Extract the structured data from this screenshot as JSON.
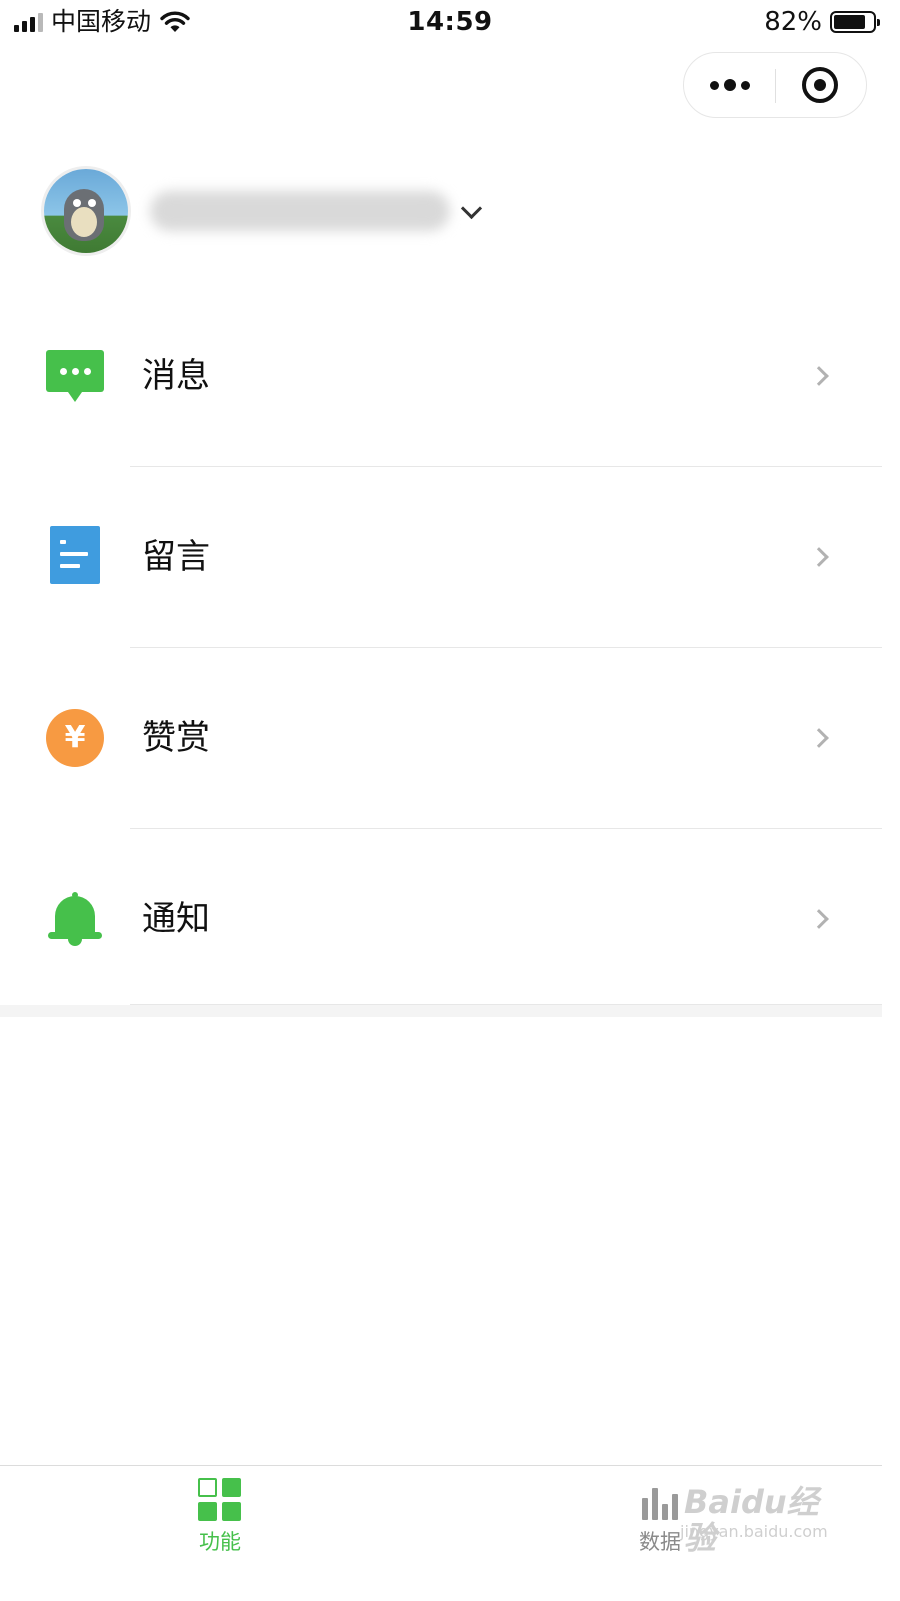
{
  "status_bar": {
    "carrier": "中国移动",
    "time": "14:59",
    "battery": "82%",
    "battery_level": 0.82
  },
  "menu": {
    "items": [
      {
        "label": "消息",
        "icon": "message-icon"
      },
      {
        "label": "留言",
        "icon": "comment-icon"
      },
      {
        "label": "赞赏",
        "icon": "reward-icon",
        "symbol": "¥"
      },
      {
        "label": "通知",
        "icon": "bell-icon"
      }
    ]
  },
  "tabbar": {
    "tabs": [
      {
        "label": "功能",
        "active": true,
        "icon": "grid-icon"
      },
      {
        "label": "数据",
        "active": false,
        "icon": "bar-chart-icon"
      }
    ]
  },
  "watermark": {
    "brand": "Baidu经验",
    "url": "jingyan.baidu.com"
  },
  "colors": {
    "accent_green": "#46c04b",
    "blue": "#3f9cdf",
    "orange": "#f79a42"
  }
}
